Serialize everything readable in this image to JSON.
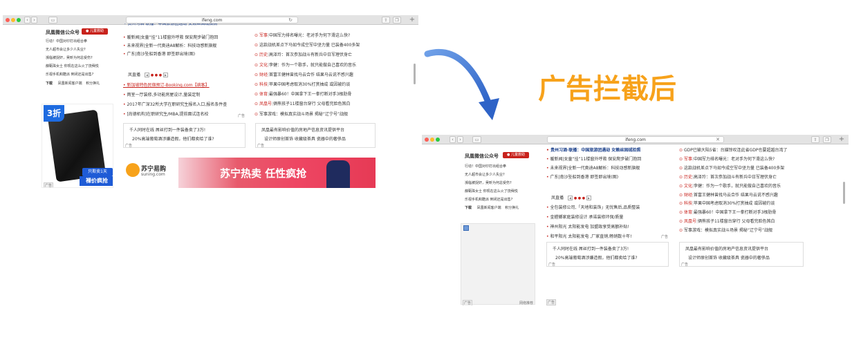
{
  "heading": "广告拦截后",
  "url": "ifeng.com",
  "before": {
    "left_title": "凤凰微信公众号",
    "left_badge": "儿童救助",
    "left_items": [
      "行动！中国对印打出组合拳",
      "无人超市会让多少人失业?",
      "濒临被捉奸，吴昕为何总受伤?",
      "薛甄珠女士 你现在这么火了饶舜悦",
      "乐视手机和酷派 倒闭还是出售?"
    ],
    "left_footer": [
      "下载",
      "凤凰新闻客户端",
      "积分换礼"
    ],
    "ad_3zhe": "3折",
    "ad_only1day": "只欺卖1天",
    "ad_price": "裸价疯抢",
    "ad_label": "广告",
    "mid_items_top": [
      "暖新闻|女童“挂”11楼窗外呼救 保安爬步破门抱回",
      "未来视界|全新一代奥迪A8解析：科技动感新旗舰",
      "广东|南沙坠船到香港 即签即出境(图)"
    ],
    "live_label": "凤直播",
    "pager": [
      "◀",
      "▶"
    ],
    "mid_items_bottom": [
      "新加坡特色民宿预订-Booking.com【缤客】",
      "两室一厅装修,多功能房屋设计,量装定制",
      "2017年广深32所大学在职研究生报名入口,报名条件查",
      "[尚德机构]在职研究生/MBA,提前面试连名校"
    ],
    "mid_ad": "广告",
    "right_items": [
      {
        "cat": "军事",
        "text": "中国军力排名曝光：老对手为何下滑这么快?"
      },
      {
        "cat": "",
        "text": "这款战机差点下马如今成空军中坚力量 已装备400多架"
      },
      {
        "cat": "历史",
        "text": "高泽玲：首次参加战斗有新兵中日军理伏身亡"
      },
      {
        "cat": "文化",
        "text": "李健：作为一个歌手，就只能做自己喜欢的音乐"
      },
      {
        "cat": "财经",
        "text": "首富王健林曾找马云合作 结果马云说不感兴趣"
      },
      {
        "cat": "科技",
        "text": "苹果中国考虑取消30%打赏抽成 或因被约谈"
      },
      {
        "cat": "体育",
        "text": "最强暴60！中国拿下王一拳打断对手3根肋骨"
      },
      {
        "cat": "凤凰号",
        "text": "俩熊孩子11楼窗台穿行 父母看完脸色煞白"
      },
      {
        "cat": "",
        "text": "军事游戏：模拟真实战斗场景 揭秘“辽宁号”战舰"
      }
    ],
    "box1": [
      "千人同时在线 屌丝打到一件装备卖了3万!",
      "20%高端葡萄酒涉嫌造假，他们都卖给了谁?"
    ],
    "box2": [
      "凤凰最有影响价值的房地产信息资讯提供平台",
      "设计师原创首饰 收藏级茶具 瓷器中的奢侈品"
    ],
    "suning_name": "苏宁易购",
    "suning_url": "suning.com",
    "banner_text": "苏宁热卖 任性疯抢"
  },
  "after": {
    "left_title": "凤凰微信公众号",
    "left_badge": "儿童救助",
    "left_items": [
      "行动！中国对印打出组合拳",
      "无人超市会让多少人失业?",
      "濒临被捉奸，吴昕为何总受伤?",
      "薛甄珠女士 你现在这么火了饶舜悦",
      "乐视手机和酷派 倒闭还是出售?"
    ],
    "left_footer": [
      "下载",
      "凤凰新闻客户端",
      "积分换礼"
    ],
    "left_ad": "广告",
    "left_ad2": "网络推荐",
    "mid_items_top": [
      "贵州习酒·联播：中国旅游团遇劫 女赖丝固绒拾照",
      "暖新闻|女童“挂”11楼窗外呼救 保安爬步破门抱回",
      "未来视界|全新一代奥迪A8解析：科技动感新旗舰",
      "广东|南沙坠船到香港 即签即出境(图)"
    ],
    "live_label": "凤直播",
    "mid_items_bottom": [
      "全包装修公司,「天地和装饰」无忧售后,品质整装",
      "金螳螂家庭装修设计 承诺装修环保/质量",
      "神州阳光 太阳能发电 加盟政享受高额补贴!",
      "和平阳光 太阳能发电 ,厂家直销,畅销数十年!"
    ],
    "mid_ad": "广告",
    "right_items": [
      {
        "cat": "",
        "text": "GDP已输大陆5省：台媒惊叹连此省GDP也要超越台湾了"
      },
      {
        "cat": "军事",
        "text": "中国军力排名曝光：老对手为何下滑这么快?"
      },
      {
        "cat": "",
        "text": "这款战机差点下马如今成空军中坚力量 已装备400多架"
      },
      {
        "cat": "历史",
        "text": "高泽玲：首次参加战斗有新兵中日军理伏身亡"
      },
      {
        "cat": "文化",
        "text": "李健：作为一个歌手，就只能做自己喜欢的音乐"
      },
      {
        "cat": "财经",
        "text": "首富王健林曾找马云合作 结果马云说不感兴趣"
      },
      {
        "cat": "科技",
        "text": "苹果中国考虑取消30%打赏抽成 或因被约谈"
      },
      {
        "cat": "体育",
        "text": "最强暴60！中国拿下王一拳打断对手3根肋骨"
      },
      {
        "cat": "凤凰号",
        "text": "俩熊孩子11楼窗台穿行 父母看完脸色煞白"
      },
      {
        "cat": "",
        "text": "军事游戏：模拟真实战斗场景 揭秘“辽宁号”战舰"
      }
    ],
    "box1": [
      "千人同时在线 屌丝打到一件装备卖了3万!",
      "20%高端葡萄酒涉嫌造假，他们都卖给了谁?"
    ],
    "box2": [
      "凤凰最有影响价值的房地产信息资讯提供平台",
      "设计师原创首饰 收藏级茶具 瓷器中的奢侈品"
    ]
  },
  "colors": {
    "accent_orange": "#f7a21b",
    "arrow_blue": "#2e63c7",
    "ifeng_red": "#c8221c",
    "link_blue": "#1a3f8a"
  }
}
